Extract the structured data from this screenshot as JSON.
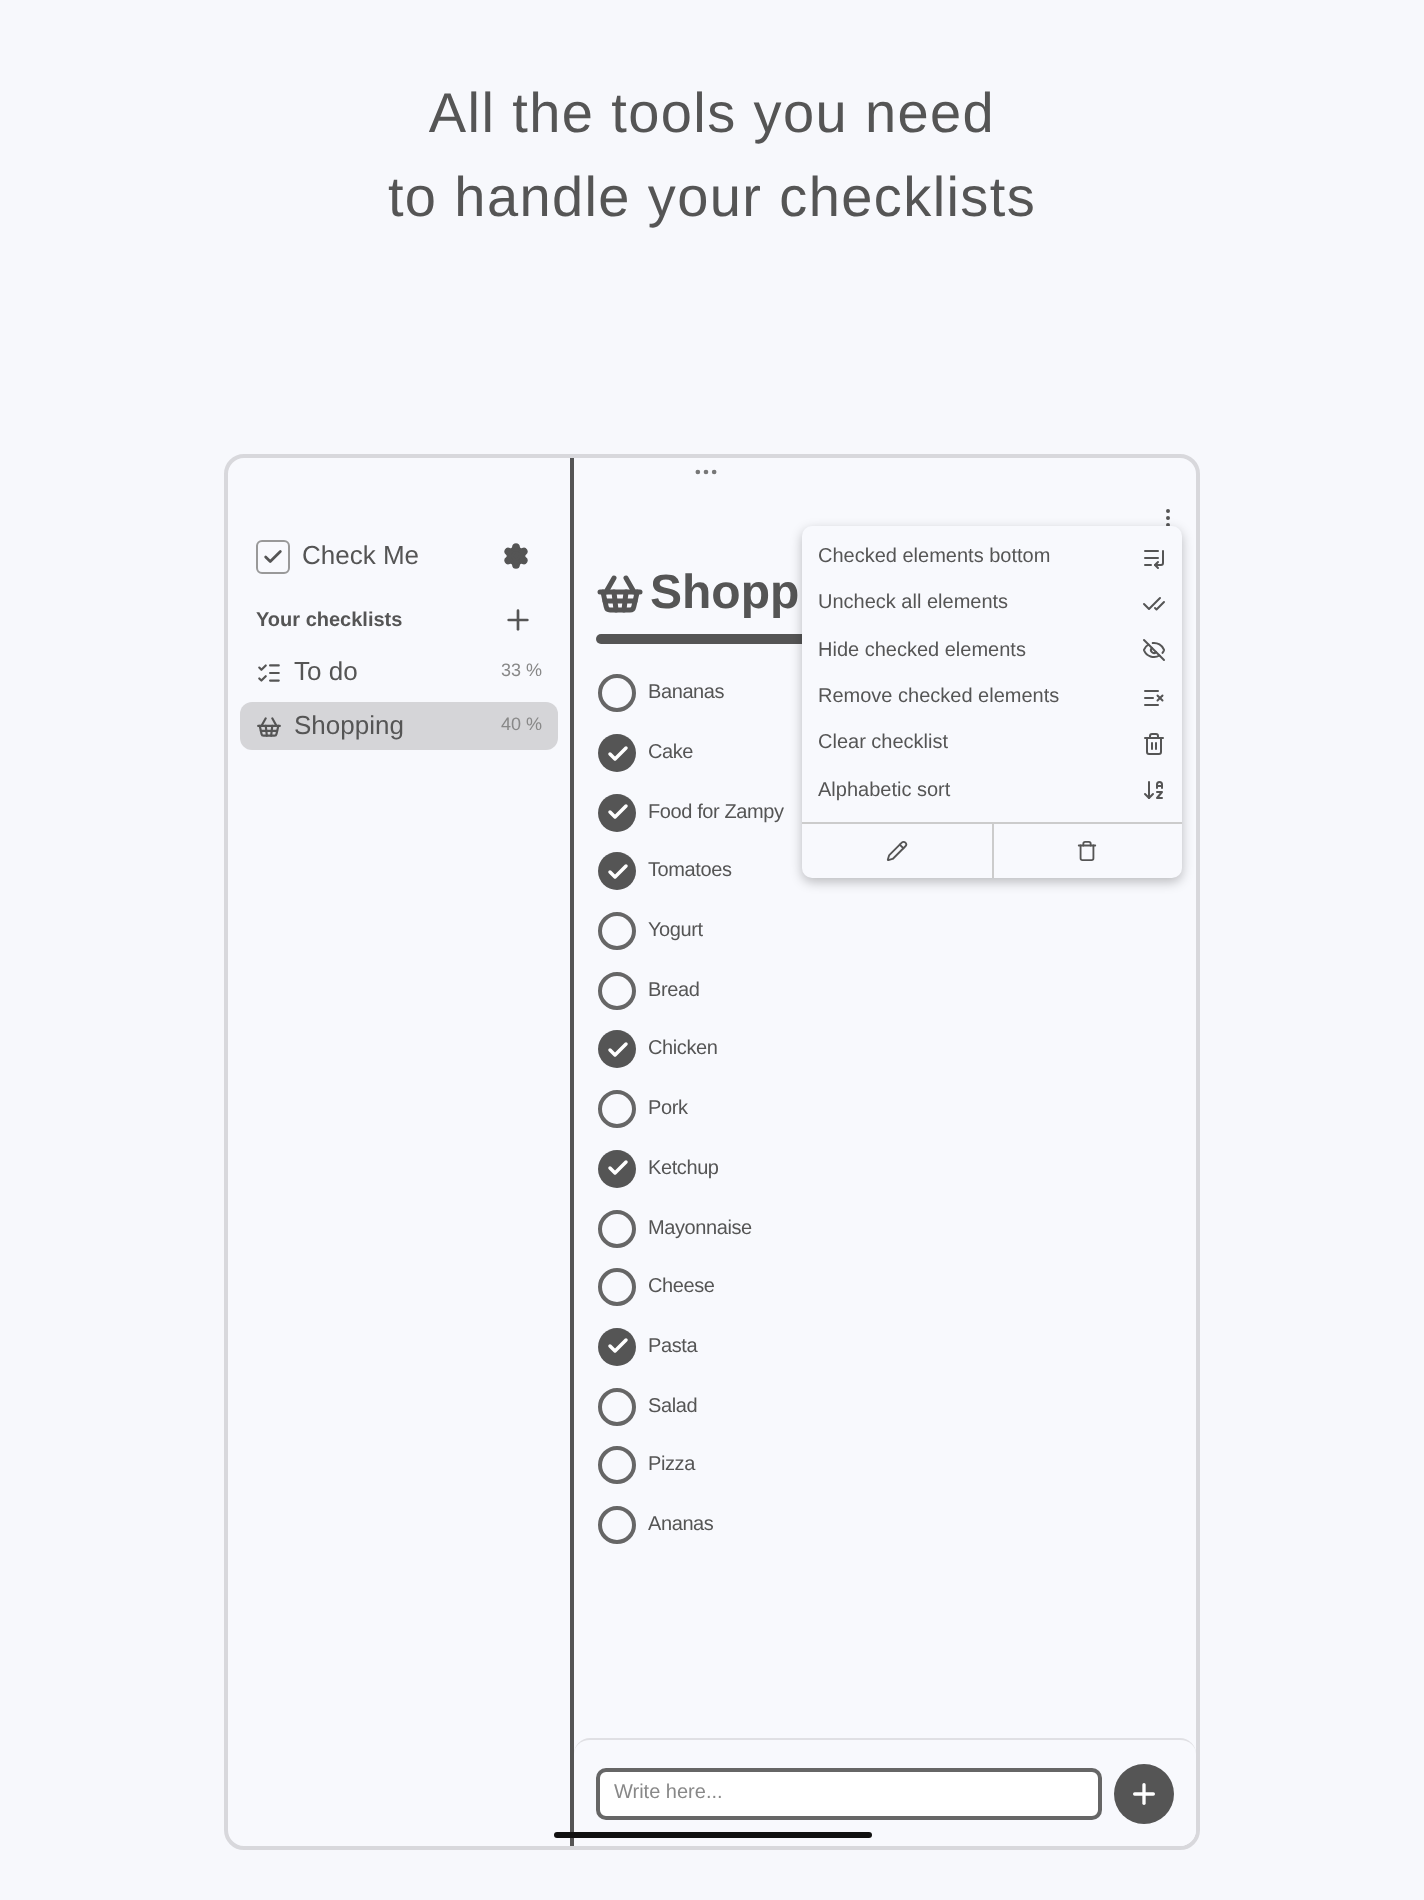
{
  "headline": [
    "All the tools you need",
    "to handle your checklists"
  ],
  "sidebar": {
    "app_name": "Check Me",
    "section_title": "Your checklists",
    "items": [
      {
        "label": "To do",
        "percent": "33 %",
        "kind": "list",
        "selected": false
      },
      {
        "label": "Shopping",
        "percent": "40 %",
        "kind": "basket",
        "selected": true
      }
    ]
  },
  "checklist": {
    "title": "Shopp",
    "items": [
      {
        "label": "Bananas",
        "checked": false
      },
      {
        "label": "Cake",
        "checked": true
      },
      {
        "label": "Food for Zampy",
        "checked": true
      },
      {
        "label": "Tomatoes",
        "checked": true
      },
      {
        "label": "Yogurt",
        "checked": false
      },
      {
        "label": "Bread",
        "checked": false
      },
      {
        "label": "Chicken",
        "checked": true
      },
      {
        "label": "Pork",
        "checked": false
      },
      {
        "label": "Ketchup",
        "checked": true
      },
      {
        "label": "Mayonnaise",
        "checked": false
      },
      {
        "label": "Cheese",
        "checked": false
      },
      {
        "label": "Pasta",
        "checked": true
      },
      {
        "label": "Salad",
        "checked": false
      },
      {
        "label": "Pizza",
        "checked": false
      },
      {
        "label": "Ananas",
        "checked": false
      }
    ]
  },
  "menu": {
    "items": [
      {
        "label": "Checked elements bottom",
        "kind": "bottom"
      },
      {
        "label": "Uncheck all elements",
        "kind": "uncheck"
      },
      {
        "label": "Hide checked elements",
        "kind": "hide"
      },
      {
        "label": "Remove checked elements",
        "kind": "remove"
      },
      {
        "label": "Clear checklist",
        "kind": "clear"
      },
      {
        "label": "Alphabetic sort",
        "kind": "sort"
      }
    ]
  },
  "input": {
    "placeholder": "Write here..."
  }
}
